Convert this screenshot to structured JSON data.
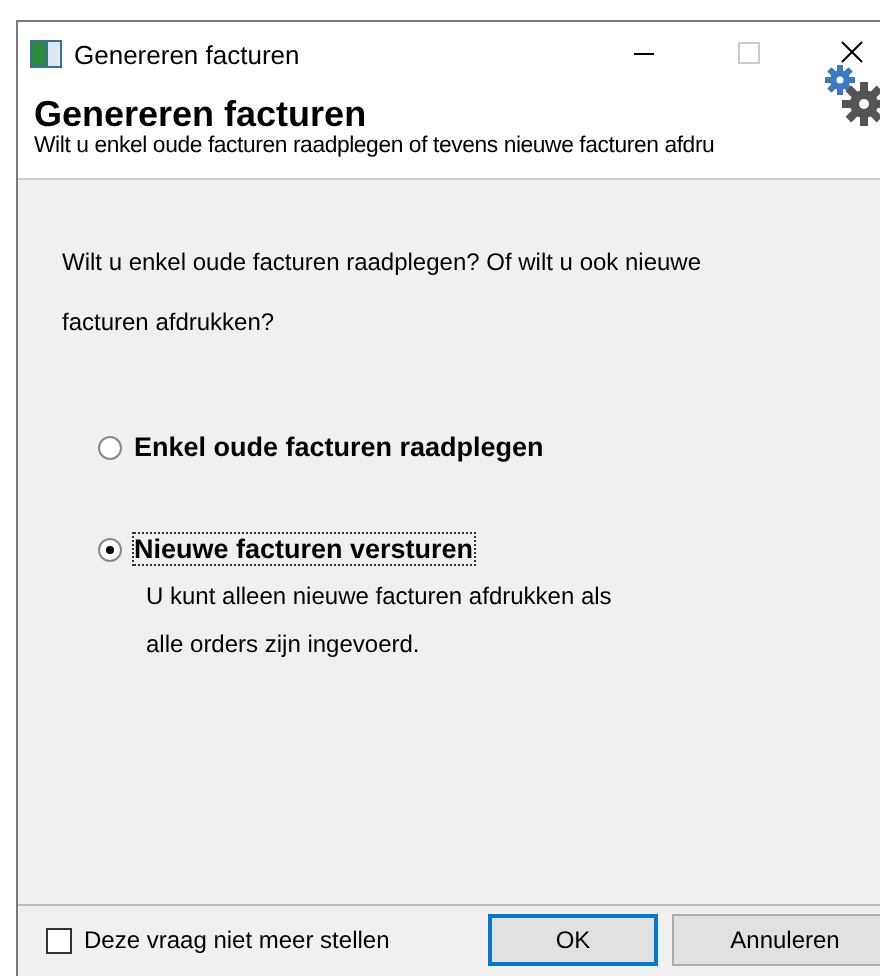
{
  "window": {
    "title": "Genereren facturen"
  },
  "header": {
    "title": "Genereren facturen",
    "subtitle": "Wilt u enkel oude facturen raadplegen of tevens nieuwe facturen afdru"
  },
  "question": "Wilt u enkel oude facturen raadplegen?  Of wilt u ook nieuwe facturen afdrukken?",
  "options": [
    {
      "label": "Enkel oude facturen raadplegen",
      "selected": false
    },
    {
      "label": "Nieuwe facturen versturen",
      "selected": true,
      "description": "U kunt alleen nieuwe facturen afdrukken als alle orders zijn ingevoerd."
    }
  ],
  "dont_ask": {
    "label": "Deze vraag niet meer stellen",
    "checked": false
  },
  "buttons": [
    {
      "label": "OK",
      "default": true
    },
    {
      "label": "Annuleren",
      "default": false
    }
  ]
}
